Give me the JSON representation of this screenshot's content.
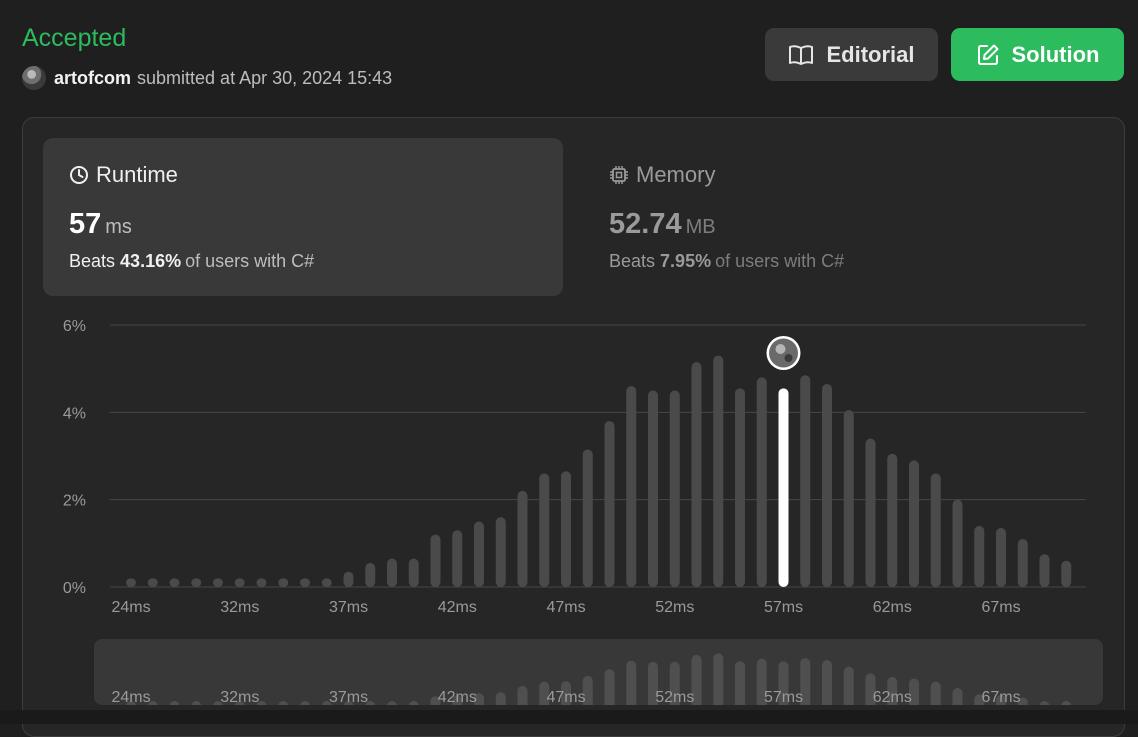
{
  "header": {
    "status": "Accepted",
    "user": "artofcom",
    "submitted_text": "submitted at Apr 30, 2024 15:43",
    "editorial_label": "Editorial",
    "solution_label": "Solution"
  },
  "runtime": {
    "title": "Runtime",
    "value": "57",
    "unit": "ms",
    "beats_label": "Beats",
    "beats_pct": "43.16%",
    "beats_rest": "of users with C#"
  },
  "memory": {
    "title": "Memory",
    "value": "52.74",
    "unit": "MB",
    "beats_label": "Beats",
    "beats_pct": "7.95%",
    "beats_rest": "of users with C#"
  },
  "colors": {
    "accent": "#2cbb5d",
    "bar": "#4a4a4a",
    "bar_selected": "#ffffff"
  },
  "chart_data": {
    "type": "bar",
    "title": "",
    "xlabel": "",
    "ylabel": "",
    "ylim": [
      0,
      6
    ],
    "y_ticks": [
      "0%",
      "2%",
      "4%",
      "6%"
    ],
    "x_ticks": [
      "24ms",
      "32ms",
      "37ms",
      "42ms",
      "47ms",
      "52ms",
      "57ms",
      "62ms",
      "67ms"
    ],
    "x_tick_bar_index": [
      0,
      5,
      10,
      15,
      20,
      25,
      30,
      35,
      40
    ],
    "values": [
      0.2,
      0.2,
      0.2,
      0.2,
      0.2,
      0.2,
      0.2,
      0.2,
      0.2,
      0.2,
      0.35,
      0.55,
      0.65,
      0.65,
      1.2,
      1.3,
      1.5,
      1.6,
      2.2,
      2.6,
      2.65,
      3.15,
      3.8,
      4.6,
      4.5,
      4.5,
      5.15,
      5.3,
      4.55,
      4.8,
      4.55,
      4.85,
      4.65,
      4.05,
      3.4,
      3.05,
      2.9,
      2.6,
      2.0,
      1.4,
      1.35,
      1.1,
      0.75,
      0.6
    ],
    "selected_index": 30,
    "grid": true
  }
}
